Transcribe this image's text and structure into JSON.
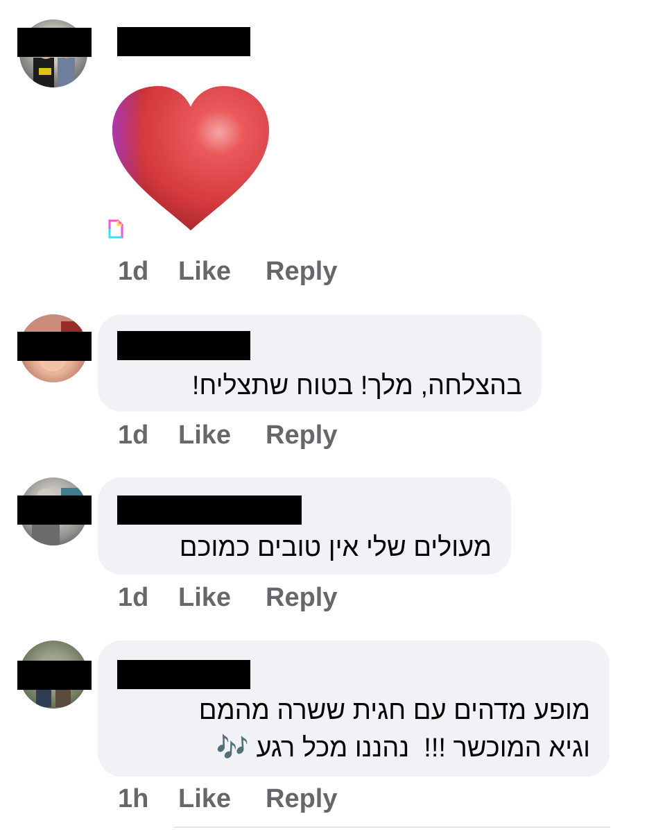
{
  "comments": [
    {
      "text": "",
      "sticker": "red-heart-sticker",
      "time": "1d",
      "like": "Like",
      "reply": "Reply"
    },
    {
      "text": "בהצלחה, מלך! בטוח שתצליח!",
      "time": "1d",
      "like": "Like",
      "reply": "Reply"
    },
    {
      "text": "מעולים שלי אין טובים כמוכם",
      "time": "1d",
      "like": "Like",
      "reply": "Reply"
    },
    {
      "line1": "מופע מדהים עם חגית ששרה מהמם",
      "line2": "וגיא המוכשר !!!  נהננו מכל רגע 🎶",
      "time": "1h",
      "like": "Like",
      "reply": "Reply"
    }
  ],
  "colors": {
    "bubble": "#f0f2f5",
    "action_text": "#65676b",
    "comment_text": "#050505",
    "heart": "#d8363c"
  }
}
